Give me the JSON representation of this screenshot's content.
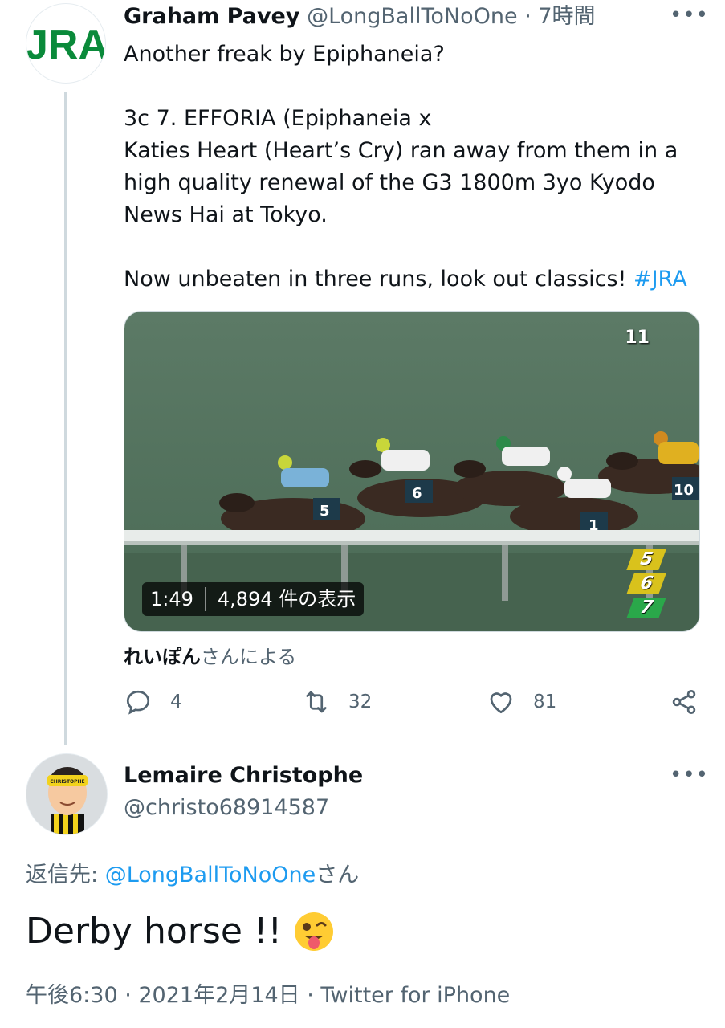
{
  "tweet": {
    "author_name": "Graham Pavey",
    "author_handle": "@LongBallToNoOne",
    "separator": "·",
    "time": "7時間",
    "lines": [
      "Another freak by Epiphaneia?",
      "3c 7. EFFORIA (Epiphaneia x",
      "Katies Heart (Heart’s Cry) ran away from them in a",
      "high quality renewal of the G3 1800m 3yo Kyodo",
      "News Hai at Tokyo.",
      "Now unbeaten in three runs, look out classics! "
    ],
    "hashtag": "#JRA",
    "avatar_text": "JRA",
    "video": {
      "duration": "1:49",
      "views": "4,894 件の表示",
      "channel_number": "11",
      "positions": [
        "5",
        "6",
        "7"
      ],
      "saddlecloths": [
        "5",
        "6",
        "1",
        "10"
      ]
    },
    "attribution_user": "れいぽん",
    "attribution_suffix": "さんによる",
    "stats": {
      "replies": "4",
      "retweets": "32",
      "likes": "81"
    }
  },
  "reply": {
    "author_name": "Lemaire Christophe",
    "author_handle": "@christo68914587",
    "avatar_text": "CHRISTOPHE",
    "reply_to_prefix": "返信先: ",
    "reply_to_handle": "@LongBallToNoOne",
    "reply_to_suffix": "さん",
    "text": "Derby horse !!",
    "emoji": "😜",
    "timestamp": "午後6:30 · 2021年2月14日 · Twitter for iPhone"
  },
  "colors": {
    "accent": "#1d9bf0",
    "secondary_text": "#536471",
    "primary_text": "#0f1419",
    "thread_line": "#cfd9de",
    "jra_green": "#0a8a3a"
  },
  "icons": [
    "more-icon",
    "reply-icon",
    "retweet-icon",
    "like-icon",
    "share-icon"
  ]
}
